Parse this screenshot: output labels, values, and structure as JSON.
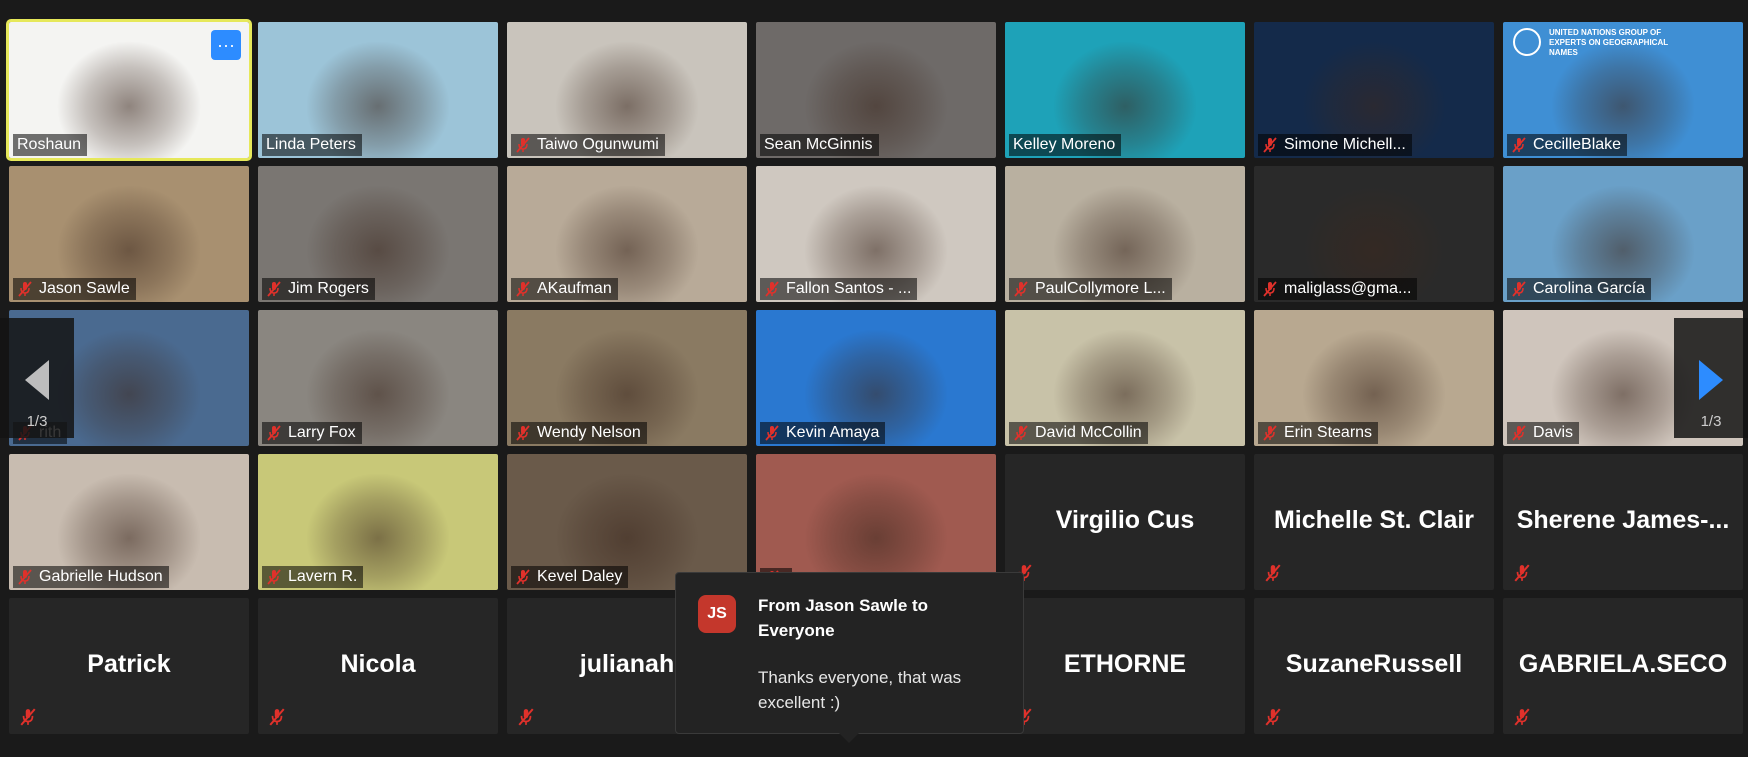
{
  "colors": {
    "background": "#1a1a1a",
    "tile_empty": "#262626",
    "active_speaker_border": "#e6e85a",
    "accent_blue": "#2d8cff",
    "mute_red": "#e0312b",
    "avatar_red": "#c4372c"
  },
  "participants": [
    {
      "name": "Roshaun",
      "video": true,
      "muted": false,
      "active": true,
      "bg": "#f4f4f2"
    },
    {
      "name": "Linda Peters",
      "video": true,
      "muted": false,
      "bg": "#9cc4d8"
    },
    {
      "name": "Taiwo Ogunwumi",
      "video": true,
      "muted": true,
      "bg": "#c9c4bc"
    },
    {
      "name": "Sean McGinnis",
      "video": true,
      "muted": false,
      "bg": "#6e6a68"
    },
    {
      "name": "Kelley Moreno",
      "video": true,
      "muted": false,
      "bg": "#1ea2b8"
    },
    {
      "name": "Simone Michell...",
      "video": true,
      "muted": true,
      "bg": "#142a4a"
    },
    {
      "name": "CecilleBlake",
      "video": true,
      "muted": true,
      "bg": "#3f8fd4",
      "banner": "UNITED NATIONS GROUP OF EXPERTS ON GEOGRAPHICAL NAMES"
    },
    {
      "name": "Jason Sawle",
      "video": true,
      "muted": true,
      "bg": "#a89070"
    },
    {
      "name": "Jim Rogers",
      "video": true,
      "muted": true,
      "bg": "#7a7672"
    },
    {
      "name": "AKaufman",
      "video": true,
      "muted": true,
      "bg": "#b8aa98"
    },
    {
      "name": "Fallon Santos - ...",
      "video": true,
      "muted": true,
      "bg": "#cfc8c0"
    },
    {
      "name": "PaulCollymore L...",
      "video": true,
      "muted": true,
      "bg": "#b9b0a0"
    },
    {
      "name": "maliglass@gma...",
      "video": true,
      "muted": true,
      "bg": "#2a2a2a"
    },
    {
      "name": "Carolina García",
      "video": true,
      "muted": true,
      "bg": "#6aa0c8"
    },
    {
      "name": "rith",
      "video": true,
      "muted": true,
      "bg": "#4a6a90"
    },
    {
      "name": "Larry Fox",
      "video": true,
      "muted": true,
      "bg": "#8a8680"
    },
    {
      "name": "Wendy Nelson",
      "video": true,
      "muted": true,
      "bg": "#8a7a62"
    },
    {
      "name": "Kevin Amaya",
      "video": true,
      "muted": true,
      "bg": "#2a78d0"
    },
    {
      "name": "David McCollin",
      "video": true,
      "muted": true,
      "bg": "#c8c2a8"
    },
    {
      "name": "Erin Stearns",
      "video": true,
      "muted": true,
      "bg": "#b8a890"
    },
    {
      "name": "Davis",
      "video": true,
      "muted": true,
      "bg": "#cfc5bc"
    },
    {
      "name": "Gabrielle Hudson",
      "video": true,
      "muted": true,
      "bg": "#c8bcb0"
    },
    {
      "name": "Lavern R.",
      "video": true,
      "muted": true,
      "bg": "#c8c878"
    },
    {
      "name": "Kevel Daley",
      "video": true,
      "muted": true,
      "bg": "#6a5a4a"
    },
    {
      "name": "",
      "video": true,
      "muted": true,
      "bg": "#a05a50"
    },
    {
      "name": "Virgilio Cus",
      "video": false,
      "muted": true
    },
    {
      "name": "Michelle St. Clair",
      "video": false,
      "muted": true
    },
    {
      "name": "Sherene  James-...",
      "video": false,
      "muted": true
    },
    {
      "name": "Patrick",
      "video": false,
      "muted": true
    },
    {
      "name": "Nicola",
      "video": false,
      "muted": true
    },
    {
      "name": "julianah",
      "video": false,
      "muted": true
    },
    {
      "name": "",
      "video": false,
      "muted": true
    },
    {
      "name": "ETHORNE",
      "video": false,
      "muted": true
    },
    {
      "name": "SuzaneRussell",
      "video": false,
      "muted": true
    },
    {
      "name": "GABRIELA.SECO",
      "video": false,
      "muted": true
    }
  ],
  "nav": {
    "prev_page": "1/3",
    "next_page": "1/3"
  },
  "more_button": {
    "label": "···"
  },
  "chat_notification": {
    "avatar_initials": "JS",
    "header": "From Jason Sawle to Everyone",
    "message": "Thanks everyone, that was excellent :)"
  }
}
